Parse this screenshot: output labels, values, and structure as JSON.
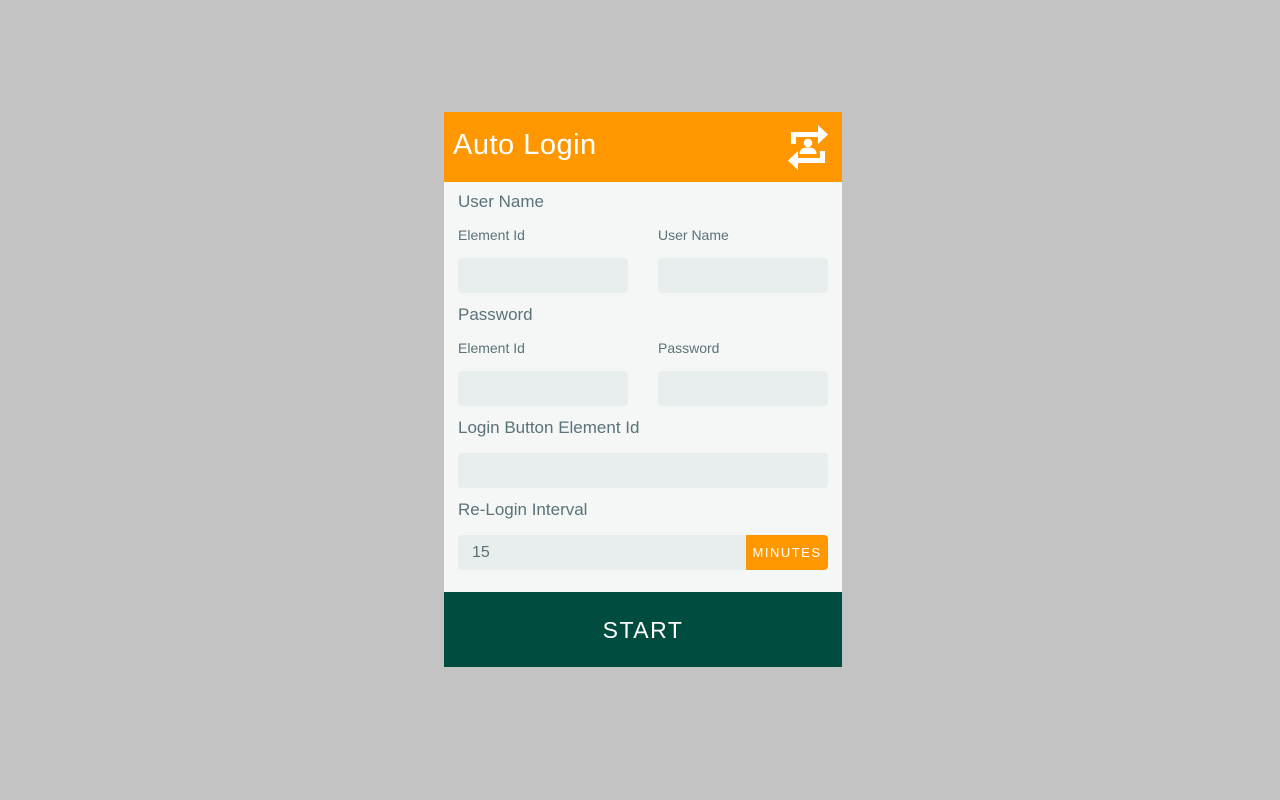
{
  "app": {
    "title": "Auto Login",
    "logo_icon": "user-swap-icon"
  },
  "colors": {
    "accent": "#ff9800",
    "primary": "#004d40",
    "background": "#c3c3c3",
    "panel": "#f5f6f6",
    "input": "#e8eded",
    "label": "#5a7378"
  },
  "username_section": {
    "heading": "User Name",
    "element_id_label": "Element Id",
    "element_id_value": "",
    "value_label": "User Name",
    "value": ""
  },
  "password_section": {
    "heading": "Password",
    "element_id_label": "Element Id",
    "element_id_value": "",
    "value_label": "Password",
    "value": ""
  },
  "login_button_section": {
    "heading": "Login Button Element Id",
    "value": ""
  },
  "interval_section": {
    "heading": "Re-Login Interval",
    "value": "15",
    "unit_label": "MINUTES"
  },
  "start_button": {
    "label": "START"
  }
}
